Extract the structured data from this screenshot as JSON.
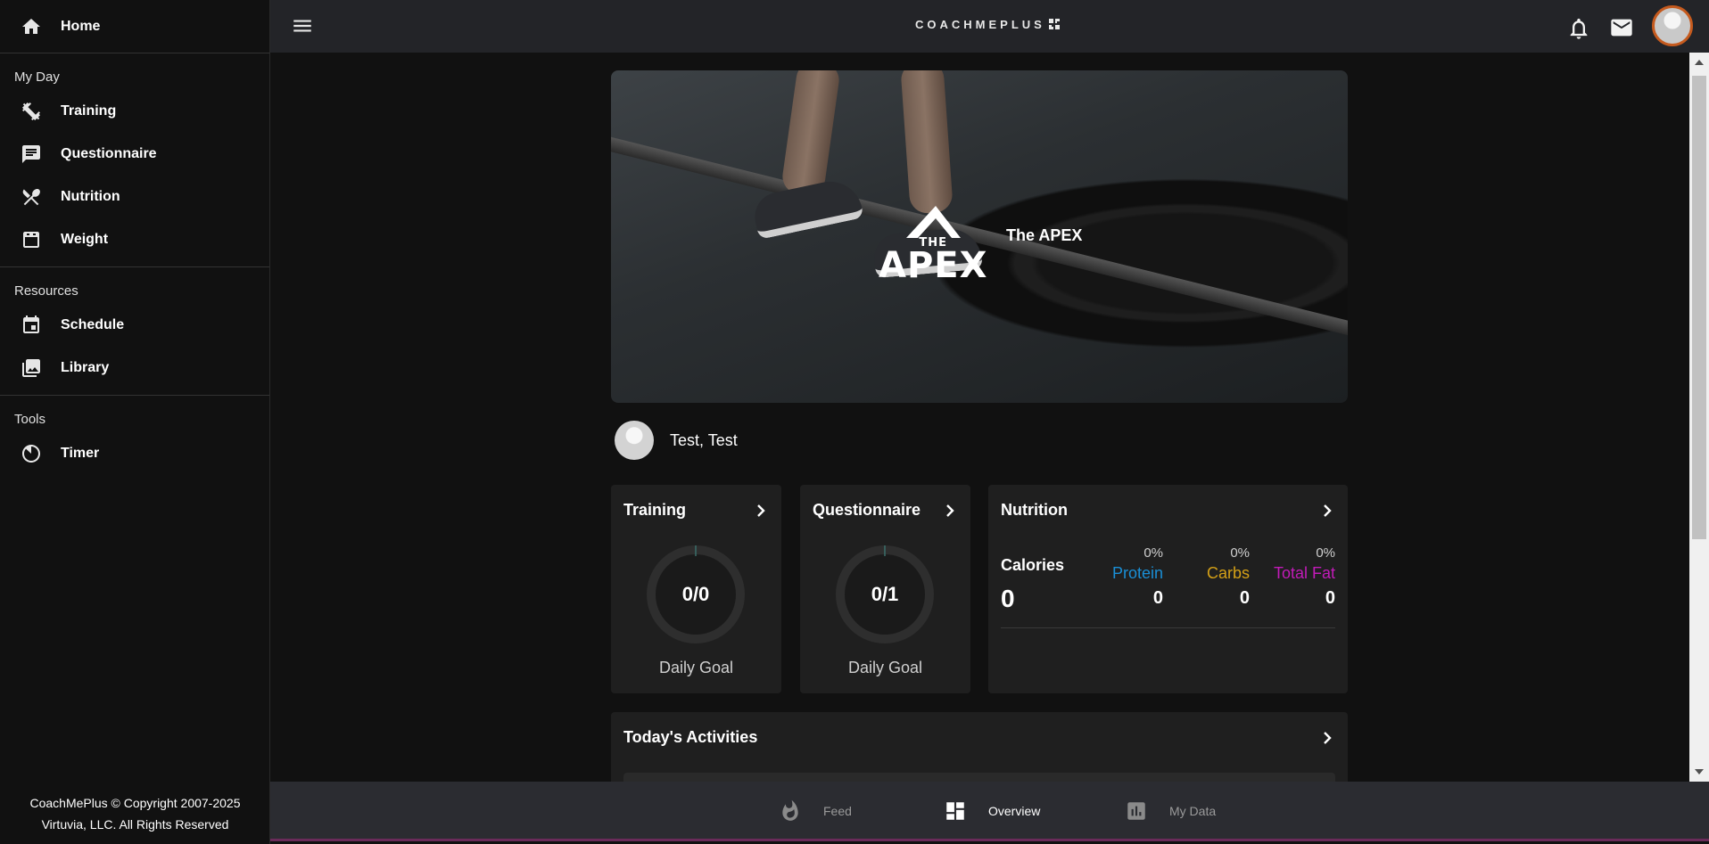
{
  "sidebar": {
    "home_label": "Home",
    "sections": [
      {
        "title": "My Day",
        "items": [
          {
            "label": "Training",
            "icon": "dumbbell-icon"
          },
          {
            "label": "Questionnaire",
            "icon": "chat-icon"
          },
          {
            "label": "Nutrition",
            "icon": "utensils-icon"
          },
          {
            "label": "Weight",
            "icon": "scale-icon"
          }
        ]
      },
      {
        "title": "Resources",
        "items": [
          {
            "label": "Schedule",
            "icon": "calendar-icon"
          },
          {
            "label": "Library",
            "icon": "library-icon"
          }
        ]
      },
      {
        "title": "Tools",
        "items": [
          {
            "label": "Timer",
            "icon": "timer-icon"
          }
        ]
      }
    ],
    "footer_line1": "CoachMePlus © Copyright 2007-2025",
    "footer_line2": "Virtuvia, LLC. All Rights Reserved"
  },
  "topbar": {
    "brand": "COACHMEPLUS"
  },
  "hero": {
    "logo_the": "THE",
    "logo_apex": "APEX",
    "title": "The APEX"
  },
  "profile": {
    "name": "Test, Test"
  },
  "training_card": {
    "title": "Training",
    "value": "0/0",
    "goal_label": "Daily Goal"
  },
  "questionnaire_card": {
    "title": "Questionnaire",
    "value": "0/1",
    "goal_label": "Daily Goal"
  },
  "nutrition_card": {
    "title": "Nutrition",
    "calories_label": "Calories",
    "calories_value": "0",
    "macros": [
      {
        "name": "Protein",
        "pct": "0%",
        "value": "0",
        "color": "#1a8fd6"
      },
      {
        "name": "Carbs",
        "pct": "0%",
        "value": "0",
        "color": "#d4a017"
      },
      {
        "name": "Total Fat",
        "pct": "0%",
        "value": "0",
        "color": "#c21bb8"
      }
    ]
  },
  "activities": {
    "title": "Today's Activities"
  },
  "bottom_nav": {
    "items": [
      {
        "label": "Feed",
        "icon": "flame-icon"
      },
      {
        "label": "Overview",
        "icon": "dashboard-icon",
        "active": true
      },
      {
        "label": "My Data",
        "icon": "bar-chart-icon"
      }
    ]
  },
  "colors": {
    "accent_avatar_border": "#c55a1e",
    "background": "#111111",
    "card": "#1f1f1f"
  }
}
